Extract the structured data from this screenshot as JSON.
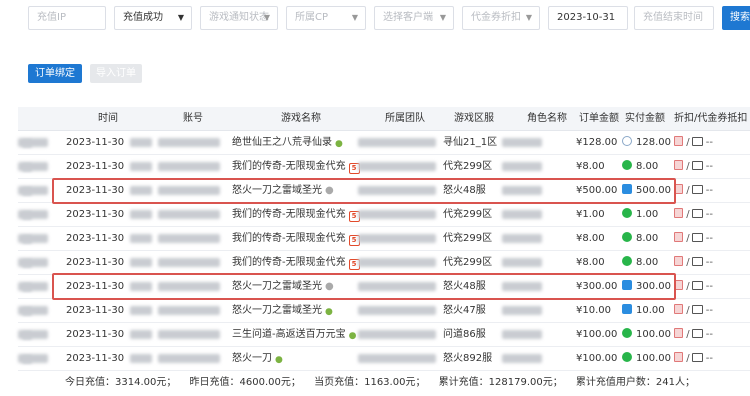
{
  "filters": {
    "recharge_ip_placeholder": "充值IP",
    "status_value": "充值成功",
    "notify_status_placeholder": "游戏通知状态",
    "cp_placeholder": "所属CP",
    "client_placeholder": "选择客户端",
    "coupon_placeholder": "代金券折扣",
    "start_date": "2023-10-31",
    "end_date_placeholder": "充值结束时间",
    "search_label": "搜索"
  },
  "actions": {
    "bind_label": "订单绑定",
    "import_label": "导入订单"
  },
  "table": {
    "headers": [
      "时间",
      "账号",
      "游戏名称",
      "所属团队",
      "游戏区服",
      "角色名称",
      "订单金额",
      "实付金额",
      "折扣/代金券抵扣"
    ],
    "rows": [
      {
        "time": "2023-11-30",
        "game": "绝世仙王之八荒寻仙录",
        "platform": "android",
        "server": "寻仙21_1区",
        "amount": "¥128.00",
        "paid": "128.00",
        "pay": "coin"
      },
      {
        "time": "2023-11-30",
        "game": "我们的传奇-无限现金代充",
        "platform": "h5",
        "server": "代充299区",
        "amount": "¥8.00",
        "paid": "8.00",
        "pay": "wechat"
      },
      {
        "time": "2023-11-30",
        "game": "怒火一刀之雷域圣光",
        "platform": "ios",
        "server": "怒火48服",
        "amount": "¥500.00",
        "paid": "500.00",
        "pay": "alipay"
      },
      {
        "time": "2023-11-30",
        "game": "我们的传奇-无限现金代充",
        "platform": "h5",
        "server": "代充299区",
        "amount": "¥1.00",
        "paid": "1.00",
        "pay": "wechat"
      },
      {
        "time": "2023-11-30",
        "game": "我们的传奇-无限现金代充",
        "platform": "h5",
        "server": "代充299区",
        "amount": "¥8.00",
        "paid": "8.00",
        "pay": "wechat"
      },
      {
        "time": "2023-11-30",
        "game": "我们的传奇-无限现金代充",
        "platform": "h5",
        "server": "代充299区",
        "amount": "¥8.00",
        "paid": "8.00",
        "pay": "wechat"
      },
      {
        "time": "2023-11-30",
        "game": "怒火一刀之雷域圣光",
        "platform": "ios",
        "server": "怒火48服",
        "amount": "¥300.00",
        "paid": "300.00",
        "pay": "alipay"
      },
      {
        "time": "2023-11-30",
        "game": "怒火一刀之雷域圣光",
        "platform": "android",
        "server": "怒火47服",
        "amount": "¥10.00",
        "paid": "10.00",
        "pay": "alipay"
      },
      {
        "time": "2023-11-30",
        "game": "三生问道-高返送百万元宝",
        "platform": "android",
        "server": "问道86服",
        "amount": "¥100.00",
        "paid": "100.00",
        "pay": "wechat"
      },
      {
        "time": "2023-11-30",
        "game": "怒火一刀",
        "platform": "android",
        "server": "怒火892服",
        "amount": "¥100.00",
        "paid": "100.00",
        "pay": "wechat"
      }
    ],
    "ops_suffix": "/",
    "ops_dash": "--"
  },
  "footer": {
    "today": "今日充值：3314.00元；",
    "yesterday": "昨日充值：4600.00元；",
    "page": "当页充值：1163.00元；",
    "total": "累计充值：128179.00元；",
    "users": "累计充值用户数：241人；"
  },
  "colors": {
    "primary": "#1e78d2",
    "highlight": "#d9544f",
    "wechat": "#28b54a",
    "alipay": "#2b8de0"
  }
}
